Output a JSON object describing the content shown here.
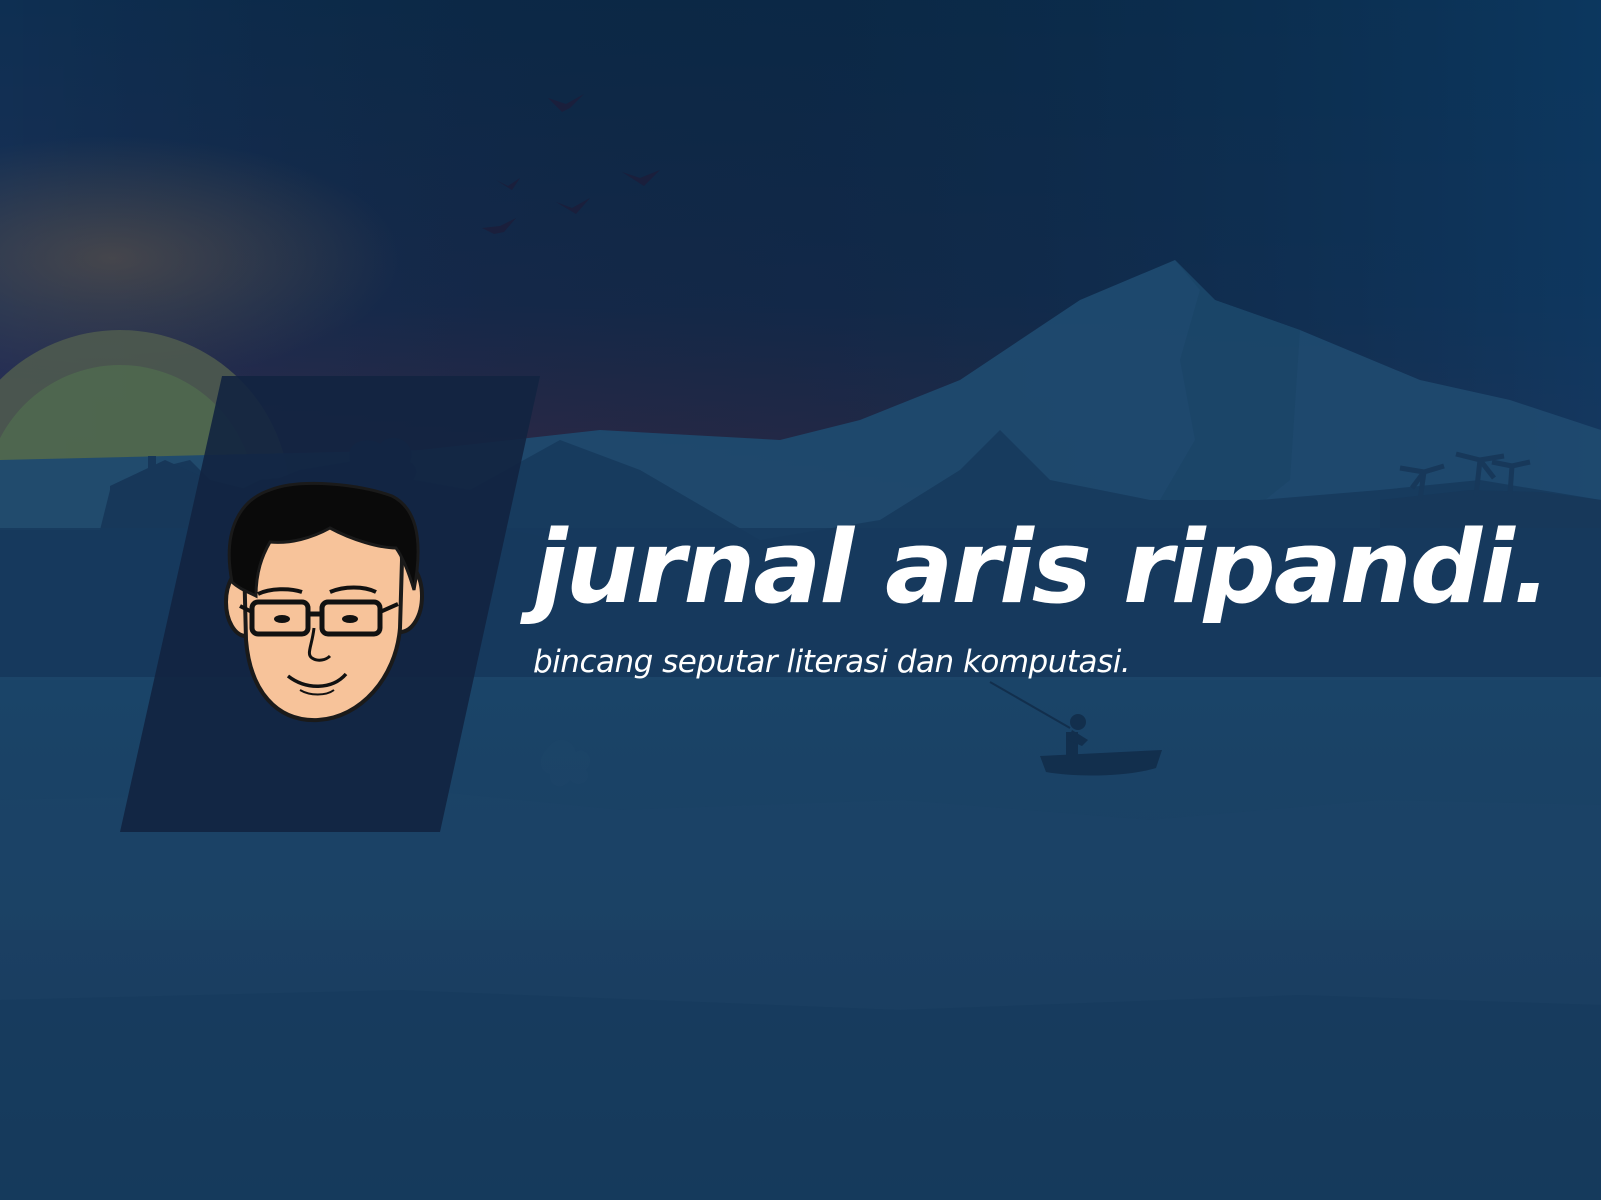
{
  "site": {
    "title": "jurnal aris ripandi.",
    "tagline": "bincang seputar literasi dan komputasi."
  },
  "colors": {
    "sky_top": "#0f3256",
    "sky_glow": "#4a3148",
    "mountain": "#1e4b70",
    "water": "#173d62",
    "avatar_panel": "#122340",
    "text": "#ffffff",
    "skin": "#f7c39a"
  },
  "icons": {
    "logo": "caricature-face-with-glasses",
    "birds": "flying-birds-silhouette",
    "boat": "fisherman-boat-silhouette"
  }
}
